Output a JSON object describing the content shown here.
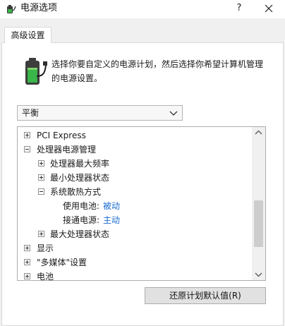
{
  "window": {
    "title": "电源选项",
    "help_glyph": "?",
    "close_glyph": "X"
  },
  "tabs": [
    {
      "label": "高级设置",
      "active": true
    }
  ],
  "description": "选择你要自定义的电源计划，然后选择你希望计算机管理的电源设置。",
  "plan_select": {
    "value": "平衡"
  },
  "tree": {
    "rows": [
      {
        "label": "PCI Express",
        "expander": "plus"
      },
      {
        "label": "处理器电源管理",
        "expander": "minus"
      },
      {
        "label": "处理器最大频率",
        "expander": "plus"
      },
      {
        "label": "最小处理器状态",
        "expander": "plus"
      },
      {
        "label": "系统散热方式",
        "expander": "minus"
      },
      {
        "label": "使用电池:",
        "value": "被动"
      },
      {
        "label": "接通电源:",
        "value": "主动"
      },
      {
        "label": "最大处理器状态",
        "expander": "plus"
      },
      {
        "label": "显示",
        "expander": "plus"
      },
      {
        "label": "\"多媒体\"设置",
        "expander": "plus"
      },
      {
        "label": "电池",
        "expander": "plus"
      }
    ]
  },
  "buttons": {
    "restore_defaults": "还原计划默认值(R)"
  },
  "colors": {
    "link": "#1a6bd1",
    "dialog_bg": "#f0f0f0",
    "scroll_thumb": "#cdcdcd"
  },
  "icons": [
    "power-options-icon",
    "battery-plug-icon",
    "chevron-down-icon",
    "scroll-up-arrow-icon",
    "scroll-down-arrow-icon"
  ]
}
